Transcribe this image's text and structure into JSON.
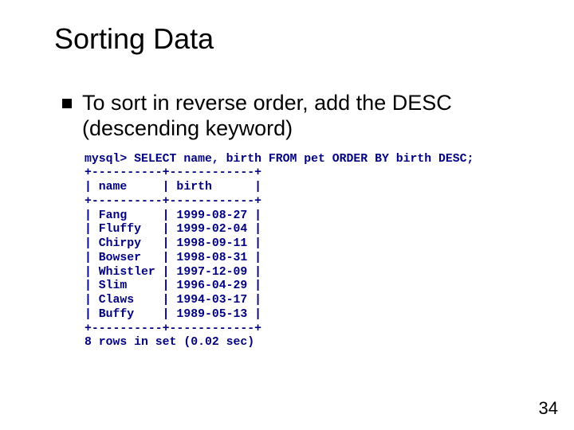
{
  "title": "Sorting Data",
  "bullet": "To sort in reverse order, add the DESC (descending keyword)",
  "code": "mysql> SELECT name, birth FROM pet ORDER BY birth DESC;\n+----------+------------+\n| name     | birth      |\n+----------+------------+\n| Fang     | 1999-08-27 |\n| Fluffy   | 1999-02-04 |\n| Chirpy   | 1998-09-11 |\n| Bowser   | 1998-08-31 |\n| Whistler | 1997-12-09 |\n| Slim     | 1996-04-29 |\n| Claws    | 1994-03-17 |\n| Buffy    | 1989-05-13 |\n+----------+------------+\n8 rows in set (0.02 sec)",
  "page_number": "34"
}
